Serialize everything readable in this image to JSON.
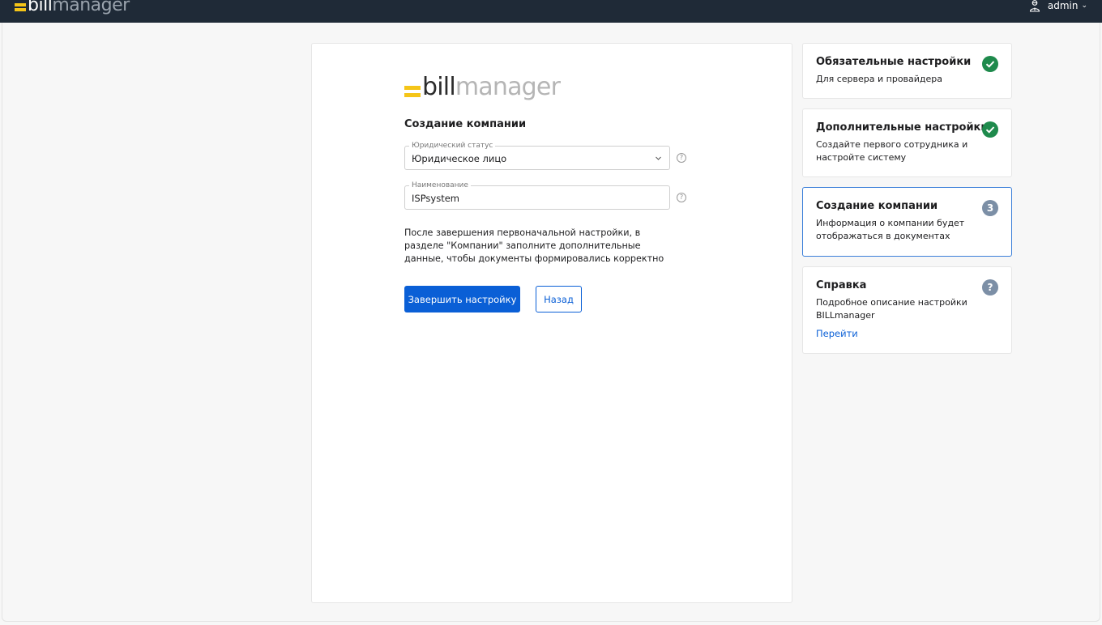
{
  "header": {
    "logo_bill": "bill",
    "logo_manager": "manager",
    "user_name": "admin",
    "user_caret": "⌄",
    "user_icon": "user-icon"
  },
  "card": {
    "logo_bill": "bill",
    "logo_manager": "manager",
    "title": "Создание компании",
    "legal_status": {
      "label": "Юридический статус",
      "value": "Юридическое лицо",
      "help": "?"
    },
    "name_field": {
      "label": "Наименование",
      "value": "ISPsystem",
      "help": "?"
    },
    "info": "После завершения первоначальной настройки, в разделе \"Компании\" заполните дополнительные данные, чтобы документы формировались корректно",
    "finish_button": "Завершить настройку",
    "back_button": "Назад"
  },
  "steps": [
    {
      "title": "Обязательные настройки",
      "desc": "Для сервера и провайдера",
      "status": "done"
    },
    {
      "title": "Дополнительные настройки",
      "desc": "Создайте первого сотрудника и настройте систему",
      "status": "done"
    },
    {
      "title": "Создание компании",
      "desc": "Информация о компании будет отображаться в документах",
      "status": "active",
      "badge": "3"
    },
    {
      "title": "Справка",
      "desc": "Подробное описание настройки BILLmanager",
      "status": "help",
      "badge": "?",
      "link": "Перейти"
    }
  ],
  "colors": {
    "topbar": "#1f2a37",
    "logo_accent": "#f5c518",
    "primary": "#0a5fd6",
    "done": "#1e8a4c",
    "step_badge": "#7c8fa6"
  }
}
